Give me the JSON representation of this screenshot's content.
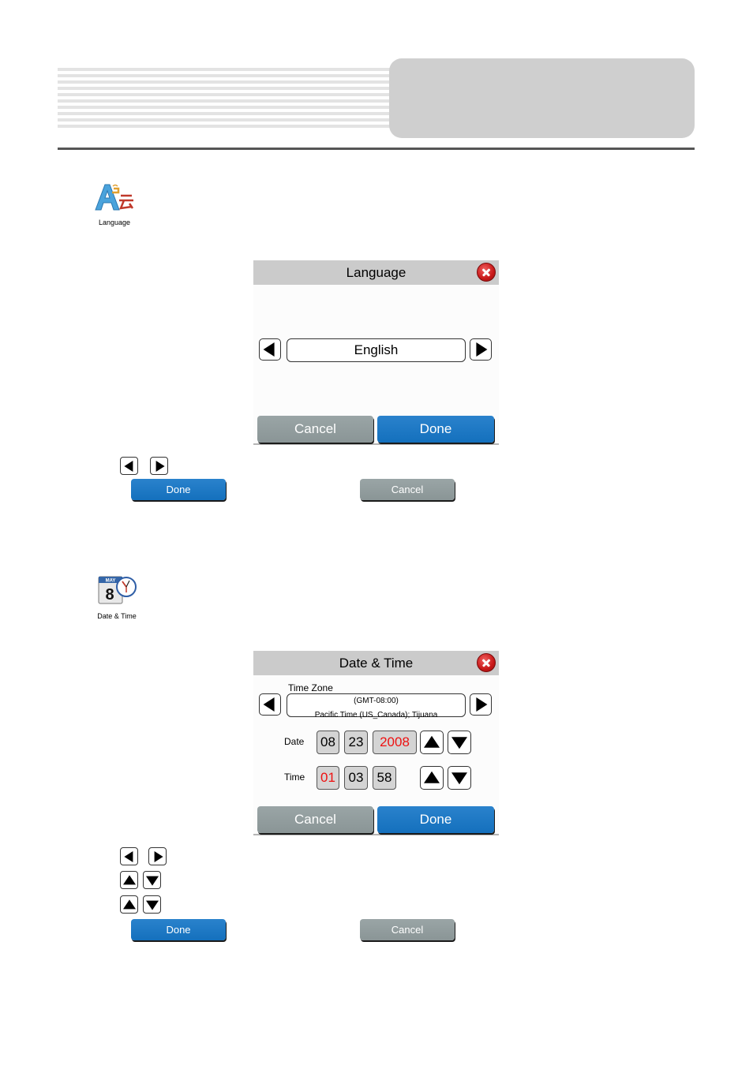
{
  "colors": {
    "done_button": "#1470bd",
    "cancel_button": "#8a9596",
    "panel_title_bg": "#cbcbcb",
    "highlight_red": "#ee1111",
    "close_red": "#c81818"
  },
  "sections": {
    "language": {
      "icon": {
        "name": "language-icon",
        "caption": "Language"
      },
      "dialog": {
        "title": "Language",
        "close_icon": "close-icon",
        "value": "English",
        "prev_icon": "left-arrow-icon",
        "next_icon": "right-arrow-icon",
        "cancel_label": "Cancel",
        "done_label": "Done"
      },
      "legend": {
        "arrows": [
          "left-arrow-icon",
          "right-arrow-icon"
        ],
        "done_label": "Done",
        "cancel_label": "Cancel"
      }
    },
    "datetime": {
      "icon": {
        "name": "calendar-clock-icon",
        "caption": "Date & Time",
        "calendar_month": "MAY",
        "calendar_day": "8"
      },
      "dialog": {
        "title": "Date & Time",
        "close_icon": "close-icon",
        "timezone_label": "Time Zone",
        "timezone_offset": "(GMT-08:00)",
        "timezone_name": "Pacific Time (US_Canada); Tijuana",
        "date_label": "Date",
        "date_month": "08",
        "date_day": "23",
        "date_year": "2008",
        "time_label": "Time",
        "time_hour": "01",
        "time_minute": "03",
        "time_second": "58",
        "selected_date_field": "year",
        "selected_time_field": "hour",
        "cancel_label": "Cancel",
        "done_label": "Done"
      },
      "legend": {
        "arrows": [
          "left-arrow-icon",
          "right-arrow-icon"
        ],
        "date_arrows": [
          "up-arrow-icon",
          "down-arrow-icon"
        ],
        "time_arrows": [
          "up-arrow-icon",
          "down-arrow-icon"
        ],
        "done_label": "Done",
        "cancel_label": "Cancel"
      }
    }
  }
}
